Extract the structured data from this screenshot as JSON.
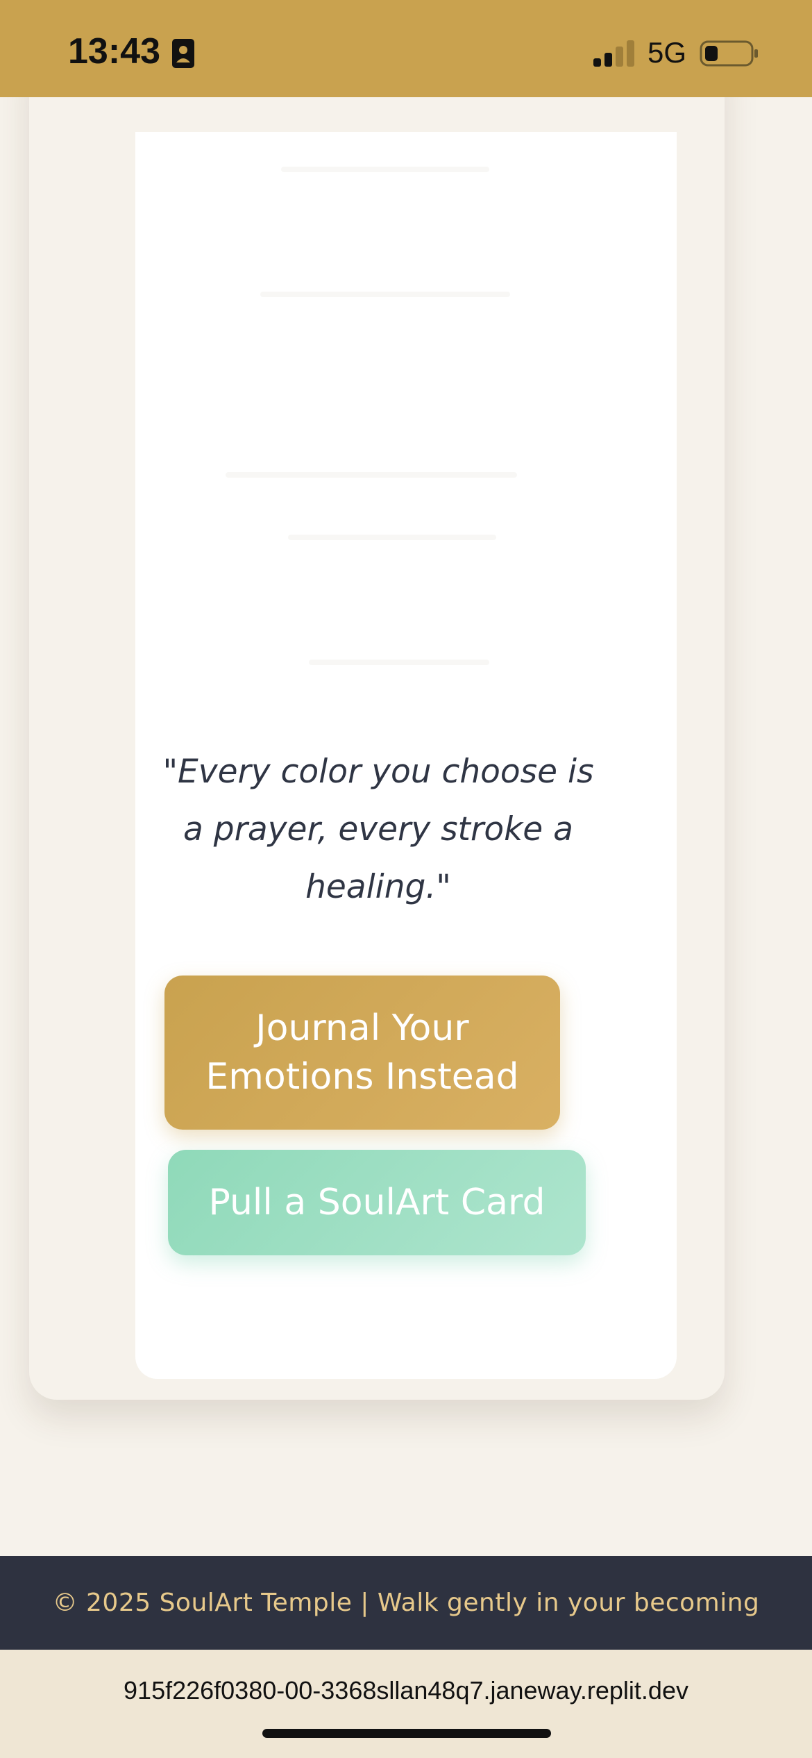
{
  "status_bar": {
    "time": "13:43",
    "network": "5G",
    "icons": [
      "contact-card-icon",
      "cellular-signal-icon",
      "battery-icon"
    ]
  },
  "main": {
    "quote": "\"Every color you choose is a prayer, every stroke a healing.\"",
    "journal_button_label": "Journal Your Emotions Instead",
    "soulart_button_label": "Pull a SoulArt Card"
  },
  "footer": {
    "text": "© 2025 SoulArt Temple | Walk gently in your becoming"
  },
  "browser": {
    "url": "915f226f0380-00-3368sllan48q7.janeway.replit.dev"
  },
  "colors": {
    "gold": "#c9a24f",
    "mint": "#9adfc2",
    "dark_navy": "#2e3240",
    "cream": "#f6f2eb",
    "footer_text": "#e7c98b"
  }
}
